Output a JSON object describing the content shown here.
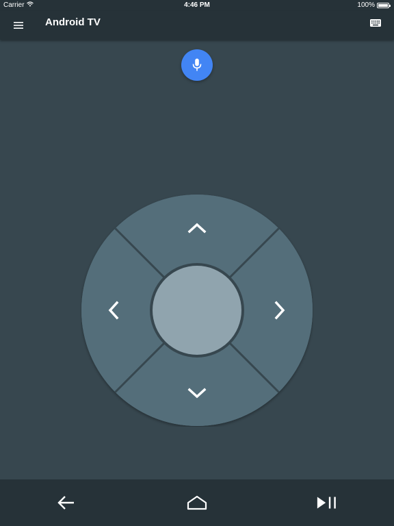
{
  "status_bar": {
    "carrier": "Carrier",
    "time": "4:46 PM",
    "battery": "100%",
    "wifi_icon": "wifi-icon",
    "battery_icon": "battery-icon"
  },
  "app_bar": {
    "title": "Android TV",
    "menu_icon": "menu-icon",
    "keyboard_icon": "keyboard-icon"
  },
  "voice": {
    "icon": "microphone-icon"
  },
  "dpad": {
    "up_icon": "chevron-up-icon",
    "down_icon": "chevron-down-icon",
    "left_icon": "chevron-left-icon",
    "right_icon": "chevron-right-icon",
    "center": "select-button"
  },
  "bottom_bar": {
    "back_icon": "back-arrow-icon",
    "home_icon": "home-icon",
    "play_pause_icon": "play-pause-icon"
  },
  "colors": {
    "background": "#37474f",
    "bars": "#263238",
    "pad": "#546e7a",
    "center_button": "#90a4ae",
    "accent": "#4285f4",
    "icon": "#ffffff"
  }
}
